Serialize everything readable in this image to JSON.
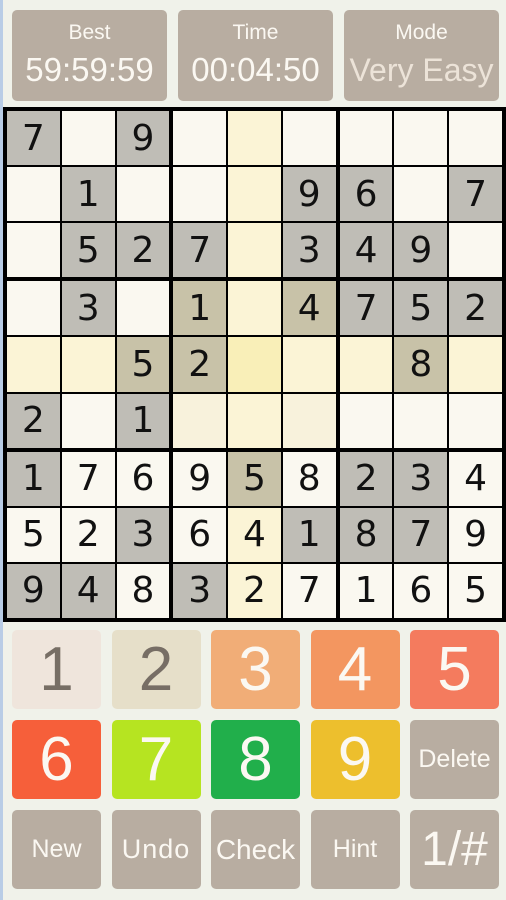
{
  "header": {
    "best": {
      "label": "Best",
      "value": "59:59:59"
    },
    "time": {
      "label": "Time",
      "value": "00:04:50"
    },
    "mode": {
      "label": "Mode",
      "value": "Very Easy"
    }
  },
  "board": {
    "selected": {
      "row": 5,
      "col": 5
    },
    "rows": [
      [
        {
          "v": 7,
          "g": true
        },
        {
          "v": 0
        },
        {
          "v": 9,
          "g": true
        },
        {
          "v": 0
        },
        {
          "v": 0
        },
        {
          "v": 0
        },
        {
          "v": 0
        },
        {
          "v": 0
        },
        {
          "v": 0
        }
      ],
      [
        {
          "v": 0
        },
        {
          "v": 1,
          "g": true
        },
        {
          "v": 0
        },
        {
          "v": 0
        },
        {
          "v": 0
        },
        {
          "v": 9,
          "g": true
        },
        {
          "v": 6,
          "g": true
        },
        {
          "v": 0
        },
        {
          "v": 7,
          "g": true
        }
      ],
      [
        {
          "v": 0
        },
        {
          "v": 5,
          "g": true
        },
        {
          "v": 2,
          "g": true
        },
        {
          "v": 7,
          "g": true
        },
        {
          "v": 0
        },
        {
          "v": 3,
          "g": true
        },
        {
          "v": 4,
          "g": true
        },
        {
          "v": 9,
          "g": true
        },
        {
          "v": 0
        }
      ],
      [
        {
          "v": 0
        },
        {
          "v": 3,
          "g": true
        },
        {
          "v": 0
        },
        {
          "v": 1,
          "g": true
        },
        {
          "v": 0
        },
        {
          "v": 4,
          "g": true
        },
        {
          "v": 7,
          "g": true
        },
        {
          "v": 5,
          "g": true
        },
        {
          "v": 2,
          "g": true
        }
      ],
      [
        {
          "v": 0
        },
        {
          "v": 0
        },
        {
          "v": 5,
          "g": true
        },
        {
          "v": 2,
          "g": true
        },
        {
          "v": 0
        },
        {
          "v": 0
        },
        {
          "v": 0
        },
        {
          "v": 8,
          "g": true
        },
        {
          "v": 0
        }
      ],
      [
        {
          "v": 2,
          "g": true
        },
        {
          "v": 0
        },
        {
          "v": 1,
          "g": true
        },
        {
          "v": 0
        },
        {
          "v": 0
        },
        {
          "v": 0
        },
        {
          "v": 0
        },
        {
          "v": 0
        },
        {
          "v": 0
        }
      ],
      [
        {
          "v": 1,
          "g": true
        },
        {
          "v": 7
        },
        {
          "v": 6
        },
        {
          "v": 9
        },
        {
          "v": 5,
          "g": true
        },
        {
          "v": 8
        },
        {
          "v": 2,
          "g": true
        },
        {
          "v": 3,
          "g": true
        },
        {
          "v": 4
        }
      ],
      [
        {
          "v": 5
        },
        {
          "v": 2
        },
        {
          "v": 3,
          "g": true
        },
        {
          "v": 6
        },
        {
          "v": 4
        },
        {
          "v": 1,
          "g": true
        },
        {
          "v": 8,
          "g": true
        },
        {
          "v": 7,
          "g": true
        },
        {
          "v": 9
        }
      ],
      [
        {
          "v": 9,
          "g": true
        },
        {
          "v": 4,
          "g": true
        },
        {
          "v": 8
        },
        {
          "v": 3,
          "g": true
        },
        {
          "v": 2
        },
        {
          "v": 7
        },
        {
          "v": 1
        },
        {
          "v": 6
        },
        {
          "v": 5
        }
      ]
    ]
  },
  "keypad": {
    "numbers": [
      {
        "label": "1",
        "bg": "#efe5dc",
        "fg": "#776e65"
      },
      {
        "label": "2",
        "bg": "#e6dfc9",
        "fg": "#776e65"
      },
      {
        "label": "3",
        "bg": "#f1ad77",
        "fg": "#fbf8f2"
      },
      {
        "label": "4",
        "bg": "#f39660",
        "fg": "#fbf8f2"
      },
      {
        "label": "5",
        "bg": "#f47b5e",
        "fg": "#fbf8f2"
      },
      {
        "label": "6",
        "bg": "#f65f3a",
        "fg": "#fbf8f2"
      },
      {
        "label": "7",
        "bg": "#b6e421",
        "fg": "#fbf8f2"
      },
      {
        "label": "8",
        "bg": "#21af4b",
        "fg": "#fbf8f2"
      },
      {
        "label": "9",
        "bg": "#edbf2d",
        "fg": "#fbf8f2"
      }
    ],
    "delete_label": "Delete",
    "new_label": "New",
    "undo_label": "Undo",
    "check_label": "Check",
    "hint_label": "Hint",
    "toggle_label": "1/#"
  }
}
